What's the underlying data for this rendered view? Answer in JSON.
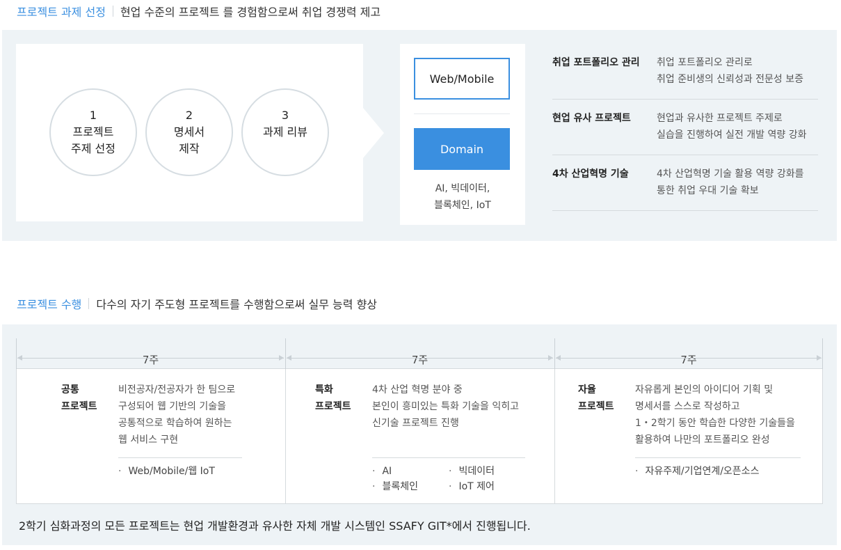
{
  "section1": {
    "highlight": "프로젝트 과제 선정",
    "text": "현업 수준의 프로젝트 를 경험함으로써 취업 경쟁력 제고",
    "steps": [
      {
        "num": "1",
        "line1": "프로젝트",
        "line2": "주제 선정"
      },
      {
        "num": "2",
        "line1": "명세서",
        "line2": "제작"
      },
      {
        "num": "3",
        "line1": "과제 리뷰",
        "line2": ""
      }
    ],
    "types": {
      "web": "Web/Mobile",
      "domain": "Domain",
      "domain_desc1": "AI, 빅데이터,",
      "domain_desc2": "블록체인, IoT"
    },
    "benefits": [
      {
        "title": "취업 포트폴리오 관리",
        "line1": "취업 포트폴리오 관리로",
        "line2": "취업 준비생의 신뢰성과 전문성 보증"
      },
      {
        "title": "현업 유사 프로젝트",
        "line1": "현업과 유사한 프로젝트 주제로",
        "line2": "실습을 진행하여 실전 개발 역량 강화"
      },
      {
        "title": "4차 산업혁명 기술",
        "line1": "4차 산업혁명 기술 활용 역량 강화를",
        "line2": "통한 취업 우대 기술 확보"
      }
    ]
  },
  "section2": {
    "highlight": "프로젝트 수행",
    "text": "다수의 자기 주도형 프로젝트를 수행함으로써 실무 능력 향상",
    "projects": [
      {
        "weeks": "7주",
        "title1": "공통",
        "title2": "프로젝트",
        "desc": [
          "비전공자/전공자가 한 팀으로",
          "구성되어 웹 기반의 기술을",
          "공통적으로 학습하여 원하는",
          "웹 서비스 구현"
        ],
        "tags": [
          "Web/Mobile/웹 IoT"
        ]
      },
      {
        "weeks": "7주",
        "title1": "특화",
        "title2": "프로젝트",
        "desc": [
          "4차 산업 혁명 분야 중",
          "본인이 흥미있는 특화 기술을 익히고",
          "신기술 프로젝트 진행"
        ],
        "tags": [
          "AI",
          "빅데이터",
          "블록체인",
          "IoT 제어"
        ]
      },
      {
        "weeks": "7주",
        "title1": "자율",
        "title2": "프로젝트",
        "desc": [
          "자유롭게 본인의 아이디어 기획 및",
          "명세서를 스스로 작성하고",
          "1・2학기 동안 학습한 다양한 기술들을",
          "활용하여 나만의 포트폴리오 완성"
        ],
        "tags": [
          "자유주제/기업연계/오픈소스"
        ]
      }
    ],
    "footnote": "2학기 심화과정의 모든 프로젝트는 현업 개발환경과 유사한 자체 개발 시스템인 SSAFY GIT*에서 진행됩니다."
  },
  "colors": {
    "accent": "#3a8fe0",
    "panel": "#eef3f6"
  }
}
